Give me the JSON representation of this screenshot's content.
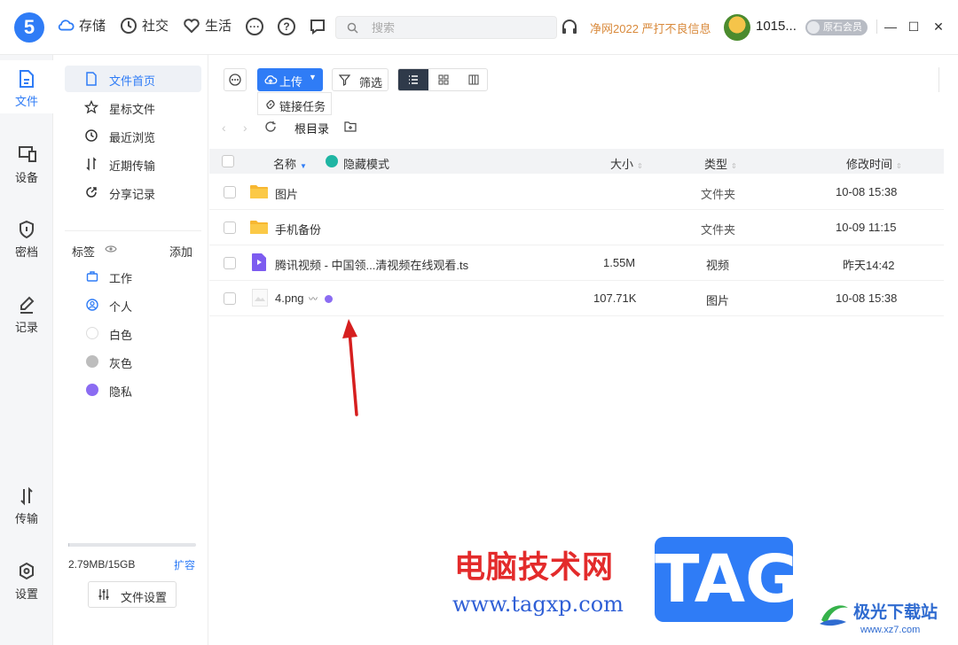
{
  "app": {
    "logo_text": "5",
    "accent": "#2f7cf6"
  },
  "topnav": {
    "storage": "存储",
    "social": "社交",
    "life": "生活",
    "search_placeholder": "搜索",
    "promo": "净网2022 严打不良信息",
    "username": "1015...",
    "vip": "原石会员"
  },
  "rail": {
    "files": "文件",
    "devices": "设备",
    "vault": "密档",
    "notes": "记录",
    "transfer": "传输",
    "settings": "设置"
  },
  "sidebar": {
    "items": [
      "文件首页",
      "星标文件",
      "最近浏览",
      "近期传输",
      "分享记录"
    ],
    "tags_title": "标签",
    "tags_add": "添加",
    "tags": [
      {
        "label": "工作",
        "color": "#2f7cf6"
      },
      {
        "label": "个人",
        "color": "#2f7cf6"
      },
      {
        "label": "白色",
        "color": "#ffffff"
      },
      {
        "label": "灰色",
        "color": "#bdbdbd"
      },
      {
        "label": "隐私",
        "color": "#8b6cf2"
      }
    ],
    "storage_used": "2.79MB/15GB",
    "storage_fraction": 0.0002,
    "expand": "扩容",
    "file_settings": "文件设置"
  },
  "toolbar": {
    "upload": "上传",
    "filter": "筛选",
    "link_task": "链接任务"
  },
  "path": {
    "root": "根目录"
  },
  "table": {
    "headers": {
      "name": "名称",
      "hidden_mode": "隐藏模式",
      "size": "大小",
      "type": "类型",
      "modified": "修改时间"
    },
    "rows": [
      {
        "name": "图片",
        "size": "",
        "type": "文件夹",
        "modified": "10-08 15:38"
      },
      {
        "name": "手机备份",
        "size": "",
        "type": "文件夹",
        "modified": "10-09 11:15"
      },
      {
        "name": "腾讯视频 - 中国领...清视频在线观看.ts",
        "size": "1.55M",
        "type": "视频",
        "modified": "昨天14:42"
      },
      {
        "name": "4.png",
        "size": "107.71K",
        "type": "图片",
        "modified": "10-08 15:38"
      }
    ]
  },
  "watermark": {
    "site_cn": "电脑技术网",
    "site_url": "www.tagxp.com",
    "tag": "TAG",
    "aurora_cn": "极光下载站",
    "aurora_url": "www.xz7.com"
  }
}
